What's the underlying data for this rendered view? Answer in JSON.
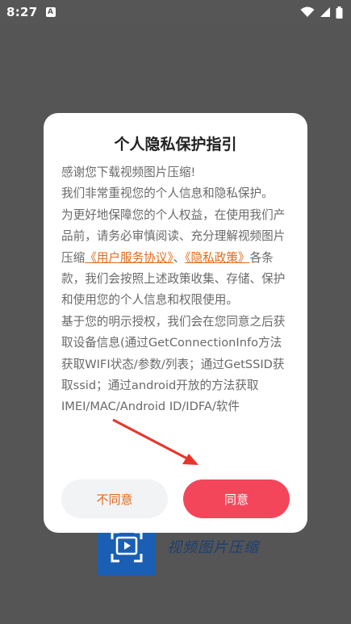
{
  "status_bar": {
    "time": "8:27",
    "app_indicator": "A",
    "icons": [
      "wifi-icon",
      "signal-icon",
      "battery-icon"
    ]
  },
  "background_app": {
    "name": "视频图片压缩",
    "logo_icon": "video-frame-icon"
  },
  "dialog": {
    "title": "个人隐私保护指引",
    "paragraphs": {
      "p1": "感谢您下载视频图片压缩!",
      "p2": "我们非常重视您的个人信息和隐私保护。",
      "p3_before": "为更好地保障您的个人权益，在使用我们产品前，请务必审慎阅读、充分理解视频图片压缩",
      "link_user_agreement": "《用户服务协议》",
      "p3_separator": "、",
      "link_privacy_policy": "《隐私政策》",
      "p3_after": "各条款，我们会按照上述政策收集、存储、保护和使用您的个人信息和权限使用。",
      "p4": "基于您的明示授权，我们会在您同意之后获取设备信息(通过GetConnectionInfo方法获取WIFI状态/参数/列表；通过GetSSID获取ssid；通过android开放的方法获取IMEI/MAC/Android ID/IDFA/软件"
    },
    "buttons": {
      "disagree": "不同意",
      "agree": "同意"
    }
  },
  "colors": {
    "accent_red": "#f4465a",
    "link_orange": "#e06a1c",
    "overlay": "#555555",
    "logo_blue": "#1a5fb4"
  }
}
